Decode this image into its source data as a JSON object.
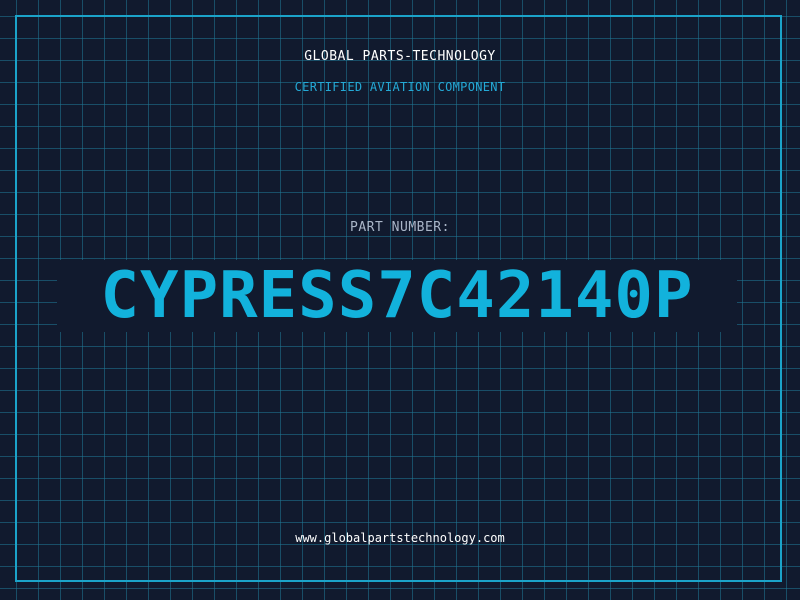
{
  "header": {
    "brand": "GLOBAL PARTS-TECHNOLOGY",
    "subtitle": "CERTIFIED AVIATION COMPONENT"
  },
  "part": {
    "label": "PART NUMBER:",
    "number": "CYPRESS7C42140P"
  },
  "footer": {
    "website": "www.globalpartstechnology.com"
  },
  "colors": {
    "background": "#111a2e",
    "grid": "#1f7896",
    "frame": "#1ba3c9",
    "accent": "#12b2dc",
    "subtitle": "#24a9d6",
    "label": "#aab6c8",
    "text": "#ffffff"
  }
}
